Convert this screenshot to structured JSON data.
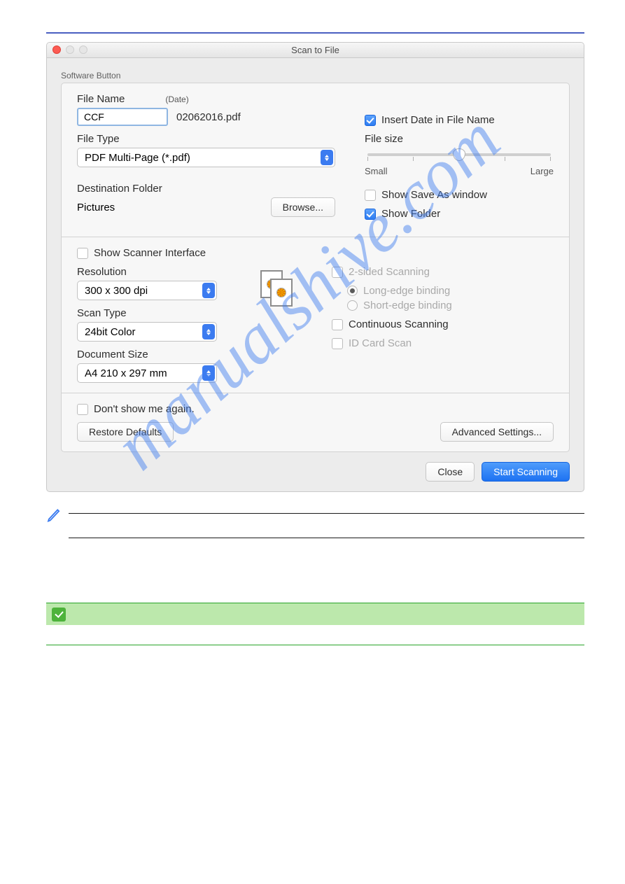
{
  "window": {
    "title": "Scan to File",
    "tab": "Software Button"
  },
  "file": {
    "name_label": "File Name",
    "date_label": "(Date)",
    "name_value": "CCF",
    "date_suffix": "02062016.pdf",
    "type_label": "File Type",
    "type_value": "PDF Multi-Page (*.pdf)",
    "dest_label": "Destination Folder",
    "dest_value": "Pictures",
    "browse_label": "Browse..."
  },
  "options": {
    "insert_date": "Insert Date in File Name",
    "file_size_label": "File size",
    "slider_small": "Small",
    "slider_large": "Large",
    "show_save_as": "Show Save As window",
    "show_folder": "Show Folder"
  },
  "scan": {
    "show_interface": "Show Scanner Interface",
    "res_label": "Resolution",
    "res_value": "300 x 300 dpi",
    "type_label": "Scan Type",
    "type_value": "24bit Color",
    "doc_label": "Document Size",
    "doc_value": "A4 210 x 297 mm",
    "two_sided": "2-sided Scanning",
    "long_edge": "Long-edge binding",
    "short_edge": "Short-edge binding",
    "continuous": "Continuous Scanning",
    "idcard": "ID Card Scan"
  },
  "footer": {
    "dont_show": "Don't show me again.",
    "restore": "Restore Defaults",
    "advanced": "Advanced Settings...",
    "close": "Close",
    "start": "Start Scanning"
  },
  "watermark": "manualshive.com"
}
